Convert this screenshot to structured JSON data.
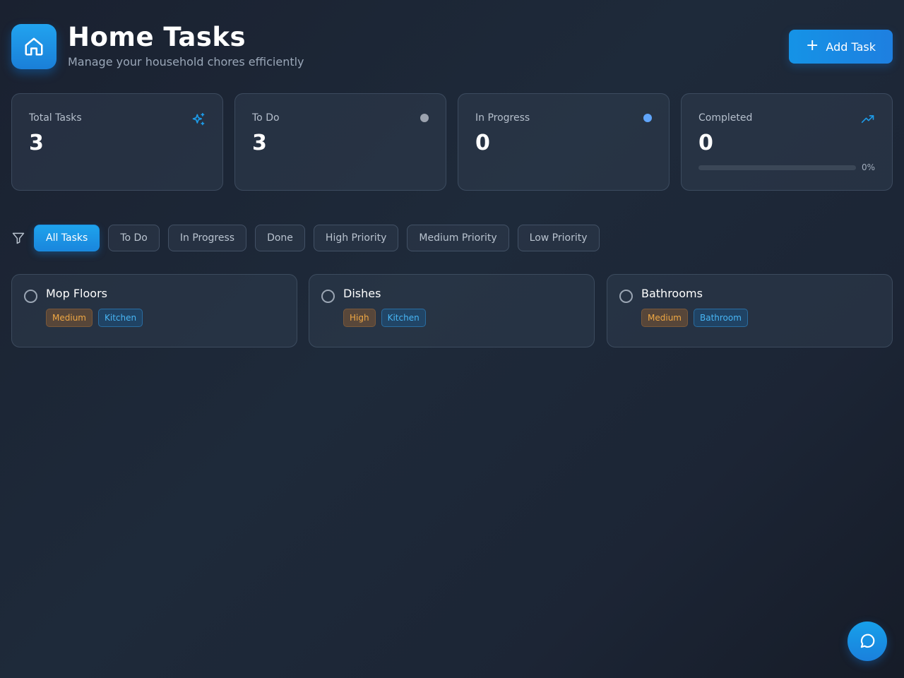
{
  "header": {
    "title": "Home Tasks",
    "subtitle": "Manage your household chores efficiently",
    "logo_icon": "home-icon",
    "add_button": {
      "label": "Add Task",
      "icon": "plus-icon"
    }
  },
  "stats": [
    {
      "label": "Total Tasks",
      "value": "3",
      "icon": "sparkles-icon"
    },
    {
      "label": "To Do",
      "value": "3",
      "indicator_color": "#9ca3af"
    },
    {
      "label": "In Progress",
      "value": "0",
      "indicator_color": "#60a5fa"
    },
    {
      "label": "Completed",
      "value": "0",
      "icon": "trending-up-icon",
      "progress_percent": 0,
      "progress_text": "0%"
    }
  ],
  "filters": {
    "icon": "filter-icon",
    "active": "All Tasks",
    "options": [
      "All Tasks",
      "To Do",
      "In Progress",
      "Done",
      "High Priority",
      "Medium Priority",
      "Low Priority"
    ]
  },
  "tasks": [
    {
      "name": "Mop Floors",
      "priority": "Medium",
      "room": "Kitchen"
    },
    {
      "name": "Dishes",
      "priority": "High",
      "room": "Kitchen"
    },
    {
      "name": "Bathrooms",
      "priority": "Medium",
      "room": "Bathroom"
    }
  ],
  "chat_button": {
    "icon": "chat-icon"
  },
  "colors": {
    "accent": "#1a8fe3",
    "priority_text": "#f0a844",
    "room_text": "#48b6f5"
  }
}
